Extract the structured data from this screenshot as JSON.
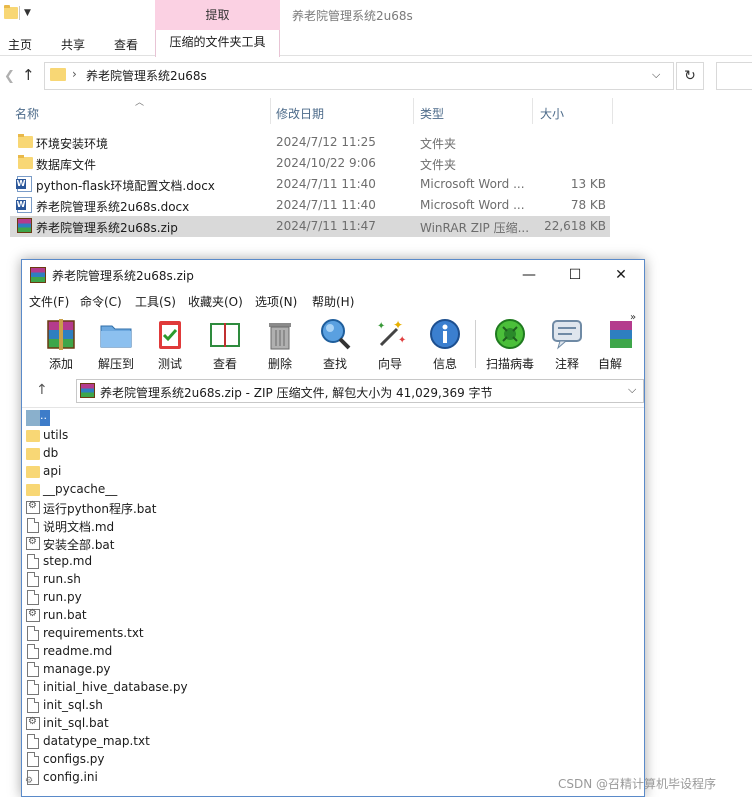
{
  "explorer": {
    "window_title": "养老院管理系统2u68s",
    "context_tab": "提取",
    "ribbon_tabs": [
      "主页",
      "共享",
      "查看",
      "压缩的文件夹工具"
    ],
    "address_path": "养老院管理系统2u68s",
    "columns": {
      "name": "名称",
      "date": "修改日期",
      "type": "类型",
      "size": "大小"
    },
    "files": [
      {
        "name": "环境安装环境",
        "date": "2024/7/12 11:25",
        "type": "文件夹",
        "size": "",
        "icon": "folder-icon"
      },
      {
        "name": "数据库文件",
        "date": "2024/10/22 9:06",
        "type": "文件夹",
        "size": "",
        "icon": "folder-icon"
      },
      {
        "name": "python-flask环境配置文档.docx",
        "date": "2024/7/11 11:40",
        "type": "Microsoft Word ...",
        "size": "13 KB",
        "icon": "word-doc-icon"
      },
      {
        "name": "养老院管理系统2u68s.docx",
        "date": "2024/7/11 11:40",
        "type": "Microsoft Word ...",
        "size": "78 KB",
        "icon": "word-doc-icon"
      },
      {
        "name": "养老院管理系统2u68s.zip",
        "date": "2024/7/11 11:47",
        "type": "WinRAR ZIP 压缩...",
        "size": "22,618 KB",
        "icon": "winrar-archive-icon",
        "selected": true
      }
    ]
  },
  "winrar": {
    "title": "养老院管理系统2u68s.zip",
    "menus": [
      "文件(F)",
      "命令(C)",
      "工具(S)",
      "收藏夹(O)",
      "选项(N)",
      "帮助(H)"
    ],
    "tools": [
      "添加",
      "解压到",
      "测试",
      "查看",
      "删除",
      "查找",
      "向导",
      "信息",
      "扫描病毒",
      "注释",
      "自解"
    ],
    "path_text": "养老院管理系统2u68s.zip - ZIP 压缩文件, 解包大小为 41,029,369 字节",
    "parent_label": "..",
    "items": [
      {
        "name": "utils",
        "kind": "folder"
      },
      {
        "name": "db",
        "kind": "folder"
      },
      {
        "name": "api",
        "kind": "folder"
      },
      {
        "name": "__pycache__",
        "kind": "folder"
      },
      {
        "name": "运行python程序.bat",
        "kind": "bat"
      },
      {
        "name": "说明文档.md",
        "kind": "file"
      },
      {
        "name": "安装全部.bat",
        "kind": "bat"
      },
      {
        "name": "step.md",
        "kind": "file"
      },
      {
        "name": "run.sh",
        "kind": "file"
      },
      {
        "name": "run.py",
        "kind": "file"
      },
      {
        "name": "run.bat",
        "kind": "bat"
      },
      {
        "name": "requirements.txt",
        "kind": "file"
      },
      {
        "name": "readme.md",
        "kind": "file"
      },
      {
        "name": "manage.py",
        "kind": "file"
      },
      {
        "name": "initial_hive_database.py",
        "kind": "file"
      },
      {
        "name": "init_sql.sh",
        "kind": "file"
      },
      {
        "name": "init_sql.bat",
        "kind": "bat"
      },
      {
        "name": "datatype_map.txt",
        "kind": "file"
      },
      {
        "name": "configs.py",
        "kind": "file"
      },
      {
        "name": "config.ini",
        "kind": "ini"
      }
    ]
  },
  "watermark": "CSDN @召精计算机毕设程序"
}
